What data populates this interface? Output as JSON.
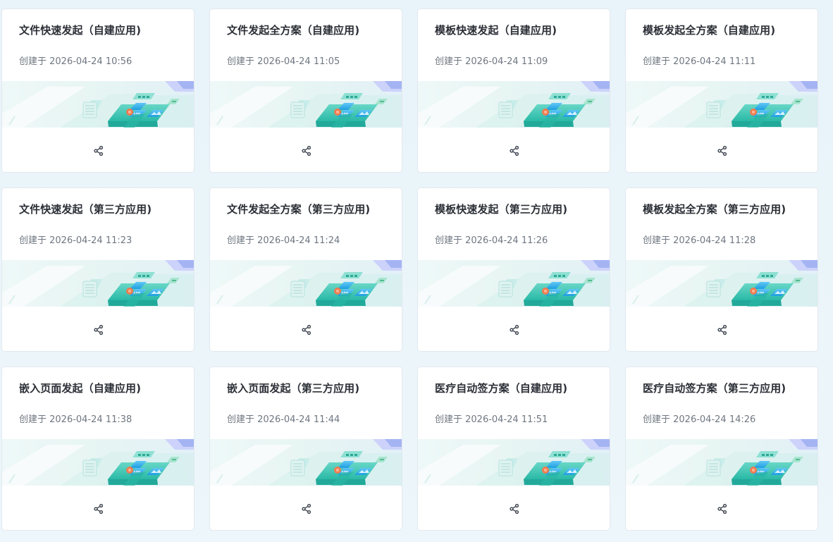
{
  "cards": [
    {
      "title": "文件快速发起（自建应用)",
      "date": "创建于 2026-04-24 10:56",
      "share_icon": "share-icon",
      "banner": "app-illustration"
    },
    {
      "title": "文件发起全方案（自建应用)",
      "date": "创建于 2026-04-24 11:05",
      "share_icon": "share-icon",
      "banner": "app-illustration"
    },
    {
      "title": "模板快速发起（自建应用)",
      "date": "创建于 2026-04-24 11:09",
      "share_icon": "share-icon",
      "banner": "app-illustration"
    },
    {
      "title": "模板发起全方案（自建应用)",
      "date": "创建于 2026-04-24 11:11",
      "share_icon": "share-icon",
      "banner": "app-illustration"
    },
    {
      "title": "文件快速发起（第三方应用)",
      "date": "创建于 2026-04-24 11:23",
      "share_icon": "share-icon",
      "banner": "app-illustration"
    },
    {
      "title": "文件发起全方案（第三方应用)",
      "date": "创建于 2026-04-24 11:24",
      "share_icon": "share-icon",
      "banner": "app-illustration"
    },
    {
      "title": "模板快速发起（第三方应用)",
      "date": "创建于 2026-04-24 11:26",
      "share_icon": "share-icon",
      "banner": "app-illustration"
    },
    {
      "title": "模板发起全方案（第三方应用)",
      "date": "创建于 2026-04-24 11:28",
      "share_icon": "share-icon",
      "banner": "app-illustration"
    },
    {
      "title": "嵌入页面发起（自建应用)",
      "date": "创建于 2026-04-24 11:38",
      "share_icon": "share-icon",
      "banner": "app-illustration"
    },
    {
      "title": "嵌入页面发起（第三方应用)",
      "date": "创建于 2026-04-24 11:44",
      "share_icon": "share-icon",
      "banner": "app-illustration"
    },
    {
      "title": "医疗自动签方案（自建应用)",
      "date": "创建于 2026-04-24 11:51",
      "share_icon": "share-icon",
      "banner": "app-illustration"
    },
    {
      "title": "医疗自动签方案（第三方应用)",
      "date": "创建于 2026-04-24 14:26",
      "share_icon": "share-icon",
      "banner": "app-illustration"
    }
  ],
  "colors": {
    "page_background": "#eaf4f9",
    "card_background": "#ffffff",
    "card_border": "#e3e8ee",
    "title_text": "#2b2f36",
    "date_text": "#6f7781",
    "banner_teal": "#35c6b1",
    "banner_blue": "#2da7e6",
    "banner_orange": "#ee7b50"
  }
}
